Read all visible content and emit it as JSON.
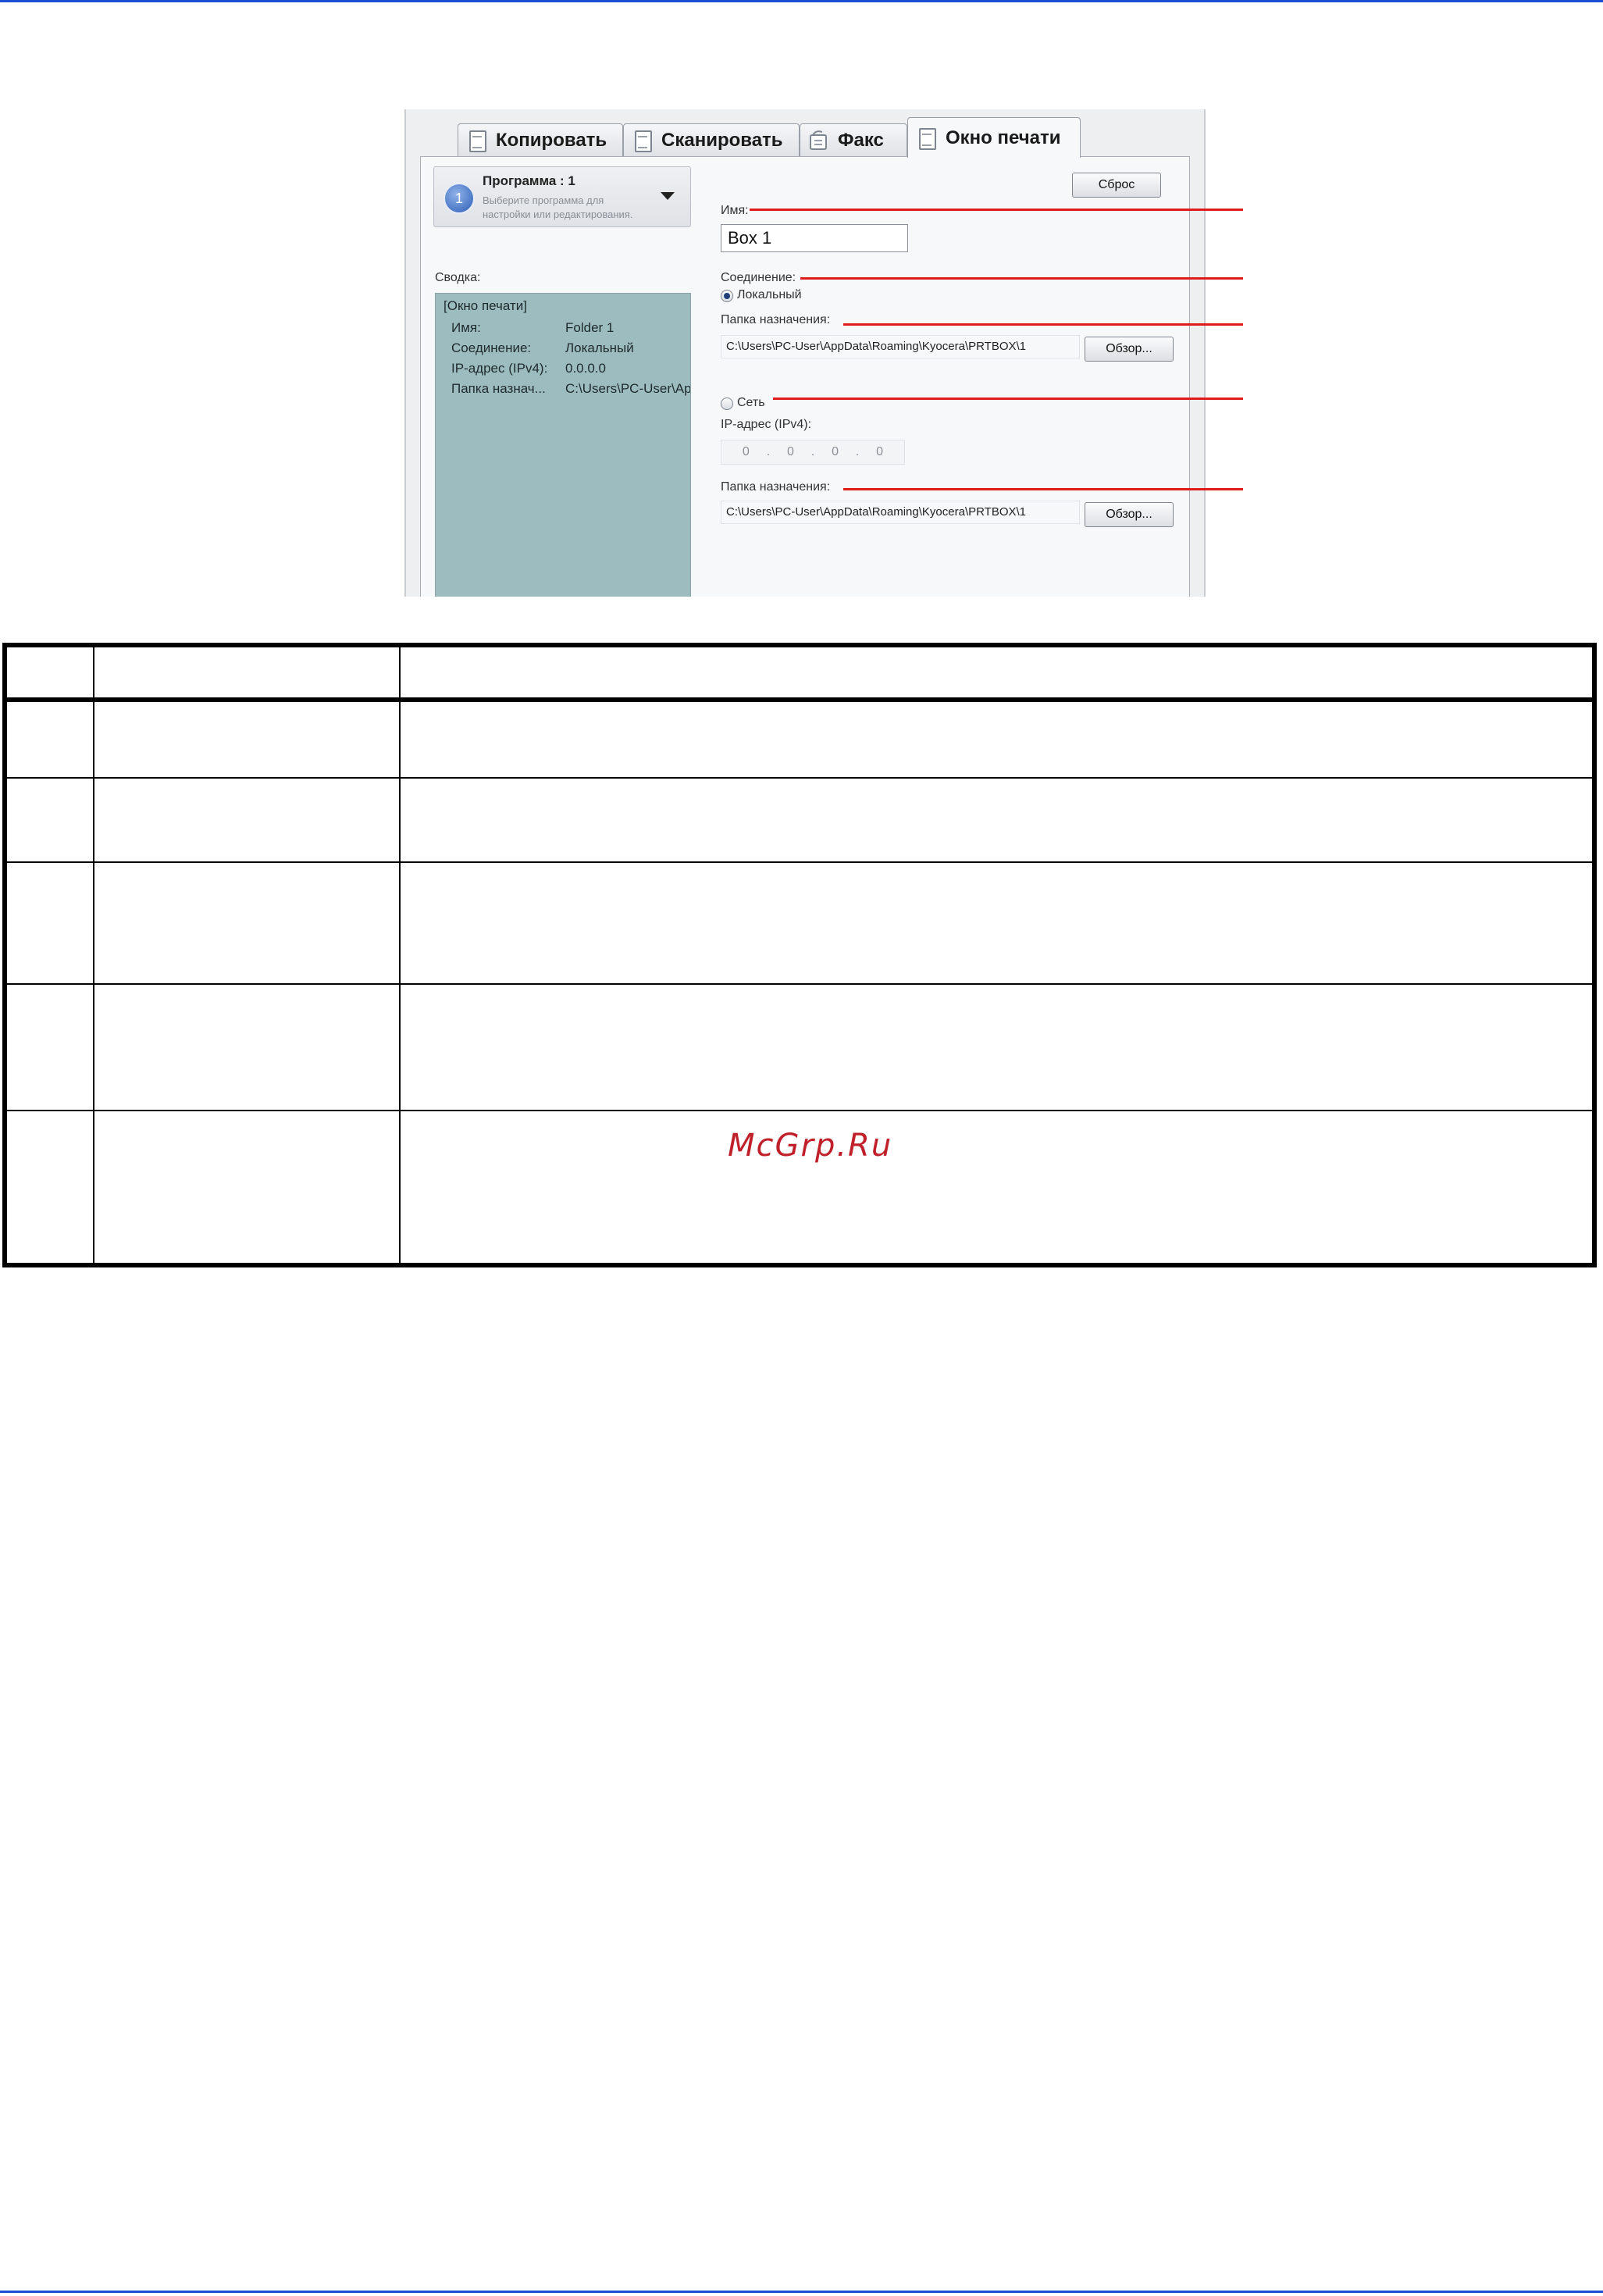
{
  "tabs": [
    {
      "label": "Копировать",
      "icon": "document-icon",
      "active": false
    },
    {
      "label": "Сканировать",
      "icon": "document-icon",
      "active": false
    },
    {
      "label": "Факс",
      "icon": "fax-icon",
      "active": false
    },
    {
      "label": "Окно печати",
      "icon": "document-icon",
      "active": true
    }
  ],
  "program": {
    "number": "1",
    "title": "Программа : 1",
    "hint": "Выберите программа для настройки или редактирования."
  },
  "summary": {
    "label": "Сводка:",
    "heading": "[Окно печати]",
    "rows": [
      {
        "key": "Имя:",
        "value": "Folder 1"
      },
      {
        "key": "Соединение:",
        "value": "Локальный"
      },
      {
        "key": "IP-адрес (IPv4):",
        "value": "0.0.0.0"
      },
      {
        "key": "Папка назнач...",
        "value": "C:\\Users\\PC-User\\Ap"
      }
    ]
  },
  "form": {
    "reset_label": "Сброс",
    "name_label": "Имя:",
    "name_value": "Box 1",
    "connection_label": "Соединение:",
    "local_label": "Локальный",
    "local_checked": true,
    "dest_label_1": "Папка назначения:",
    "dest_value_1": "C:\\Users\\PC-User\\AppData\\Roaming\\Kyocera\\PRTBOX\\1",
    "browse_label_1": "Обзор...",
    "network_label": "Сеть",
    "network_checked": false,
    "ip_label": "IP-адрес (IPv4):",
    "ip_octets": [
      "0",
      ".",
      "0",
      ".",
      "0",
      ".",
      "0"
    ],
    "dest_label_2": "Папка назначения:",
    "dest_value_2": "C:\\Users\\PC-User\\AppData\\Roaming\\Kyocera\\PRTBOX\\1",
    "browse_label_2": "Обзор..."
  },
  "watermark": "McGrp.Ru",
  "colors": {
    "rule": "#1d4fd6",
    "callout": "#e01b1b",
    "summary_bg": "#9cbcc0"
  }
}
